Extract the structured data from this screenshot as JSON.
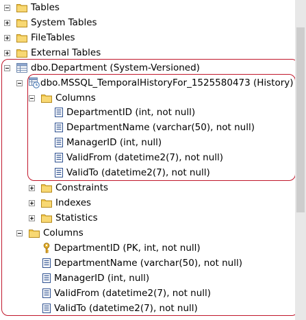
{
  "tree": {
    "tables": "Tables",
    "system_tables": "System Tables",
    "file_tables": "FileTables",
    "external_tables": "External Tables",
    "department": "dbo.Department (System-Versioned)",
    "history": "dbo.MSSQL_TemporalHistoryFor_1525580473 (History)",
    "history_columns_folder": "Columns",
    "history_columns": [
      "DepartmentID (int, not null)",
      "DepartmentName (varchar(50), not null)",
      "ManagerID (int, null)",
      "ValidFrom (datetime2(7), not null)",
      "ValidTo (datetime2(7), not null)"
    ],
    "constraints": "Constraints",
    "indexes": "Indexes",
    "statistics": "Statistics",
    "columns_folder": "Columns",
    "columns": [
      "DepartmentID (PK, int, not null)",
      "DepartmentName (varchar(50), not null)",
      "ManagerID (int, null)",
      "ValidFrom (datetime2(7), not null)",
      "ValidTo (datetime2(7), not null)"
    ]
  },
  "icons": {
    "folder": "folder-icon",
    "table": "table-icon",
    "history_table": "history-table-icon",
    "column": "column-icon",
    "key": "key-icon",
    "expand": "expand-icon",
    "collapse": "collapse-icon"
  },
  "colors": {
    "highlight_ring": "#c0162a",
    "folder": "#f0c64a",
    "column_icon": "#2c4f8f"
  }
}
